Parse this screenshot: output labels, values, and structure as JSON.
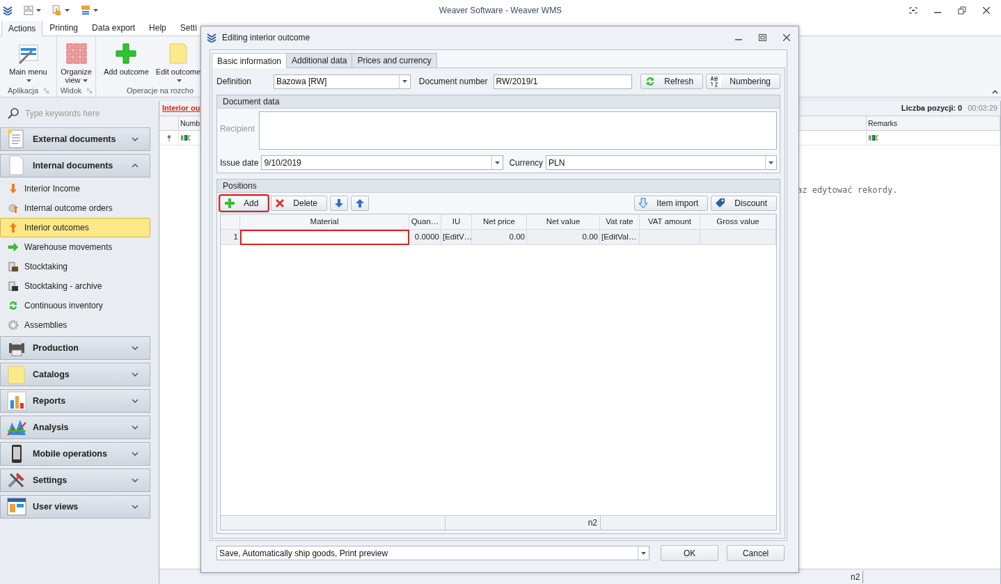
{
  "app": {
    "title": "Weaver Software - Weaver WMS"
  },
  "ribbon": {
    "tabs": [
      {
        "label": "Actions",
        "selected": true
      },
      {
        "label": "Printing",
        "selected": false
      },
      {
        "label": "Data export",
        "selected": false
      },
      {
        "label": "Help",
        "selected": false
      },
      {
        "label": "Setti",
        "selected": false
      }
    ],
    "groups": [
      {
        "label": "Aplikacja",
        "buttons": [
          {
            "label": "Main menu",
            "dropdown": true
          }
        ]
      },
      {
        "label": "Widok",
        "buttons": [
          {
            "label": "Organize view",
            "dropdown": true
          }
        ]
      },
      {
        "label": "Operacje na rozcho",
        "buttons": [
          {
            "label": "Add outcome",
            "dropdown": false
          },
          {
            "label": "Edit outcome",
            "dropdown": true
          }
        ]
      }
    ]
  },
  "sidebar": {
    "search": {
      "placeholder": "Type keywords here"
    },
    "groups": [
      {
        "label": "External documents",
        "expanded": false
      },
      {
        "label": "Internal documents",
        "expanded": true,
        "items": [
          {
            "label": "Interior Income",
            "selected": false
          },
          {
            "label": "Internal outcome orders",
            "selected": false
          },
          {
            "label": "Interior outcomes",
            "selected": true
          },
          {
            "label": "Warehouse movements",
            "selected": false
          },
          {
            "label": "Stocktaking",
            "selected": false
          },
          {
            "label": "Stocktaking - archive",
            "selected": false
          },
          {
            "label": "Continuous inventory",
            "selected": false
          },
          {
            "label": "Assemblies",
            "selected": false
          }
        ]
      },
      {
        "label": "Production",
        "expanded": false
      },
      {
        "label": "Catalogs",
        "expanded": false
      },
      {
        "label": "Reports",
        "expanded": false
      },
      {
        "label": "Analysis",
        "expanded": false
      },
      {
        "label": "Mobile operations",
        "expanded": false
      },
      {
        "label": "Settings",
        "expanded": false
      },
      {
        "label": "User views",
        "expanded": false
      }
    ]
  },
  "main": {
    "title": "Interior ou",
    "count": "Liczba pozycji: 0",
    "timer": "00:03:29",
    "columns": [
      "Numb",
      "Remarks"
    ],
    "message": "az edytować rekordy.",
    "footer": "n2"
  },
  "dialog": {
    "title": "Editing interior outcome",
    "tabs": [
      {
        "label": "Basic information",
        "selected": true
      },
      {
        "label": "Additional data",
        "selected": false
      },
      {
        "label": "Prices and currency",
        "selected": false
      }
    ],
    "definition": {
      "label": "Definition",
      "value": "Bazowa [RW]"
    },
    "document_number": {
      "label": "Document number",
      "value": "RW/2019/1"
    },
    "actions": [
      {
        "kind": "refresh",
        "label": "Refresh"
      },
      {
        "kind": "numbering",
        "label": "Numbering"
      }
    ],
    "document_data": {
      "title": "Document data",
      "recipient_label": "Recipient",
      "issue_date": {
        "label": "Issue date",
        "value": "9/10/2019"
      },
      "currency": {
        "label": "Currency",
        "value": "PLN"
      }
    },
    "positions": {
      "title": "Positions",
      "toolbar": [
        {
          "kind": "add",
          "label": "Add",
          "highlighted": true
        },
        {
          "kind": "delete",
          "label": "Delete",
          "highlighted": false
        },
        {
          "kind": "down",
          "highlighted": false
        },
        {
          "kind": "up",
          "highlighted": false
        }
      ],
      "toolbar_right": [
        {
          "kind": "import",
          "label": "Item import"
        },
        {
          "kind": "discount",
          "label": "Discount"
        }
      ],
      "columns": [
        "Material",
        "Quan…",
        "IU",
        "Net price",
        "Net value",
        "Vat rate",
        "VAT amount",
        "Gross value"
      ],
      "rows": [
        {
          "number": "1",
          "quantity": "0.0000",
          "iu": "[EditV…",
          "net_price": "0.00",
          "net_value": "0.00",
          "vat_rate": "[EditVal…",
          "editing": true
        }
      ],
      "footer": "n2"
    },
    "save_mode": "Save, Automatically ship goods, Print preview",
    "buttons": [
      "OK",
      "Cancel"
    ]
  }
}
